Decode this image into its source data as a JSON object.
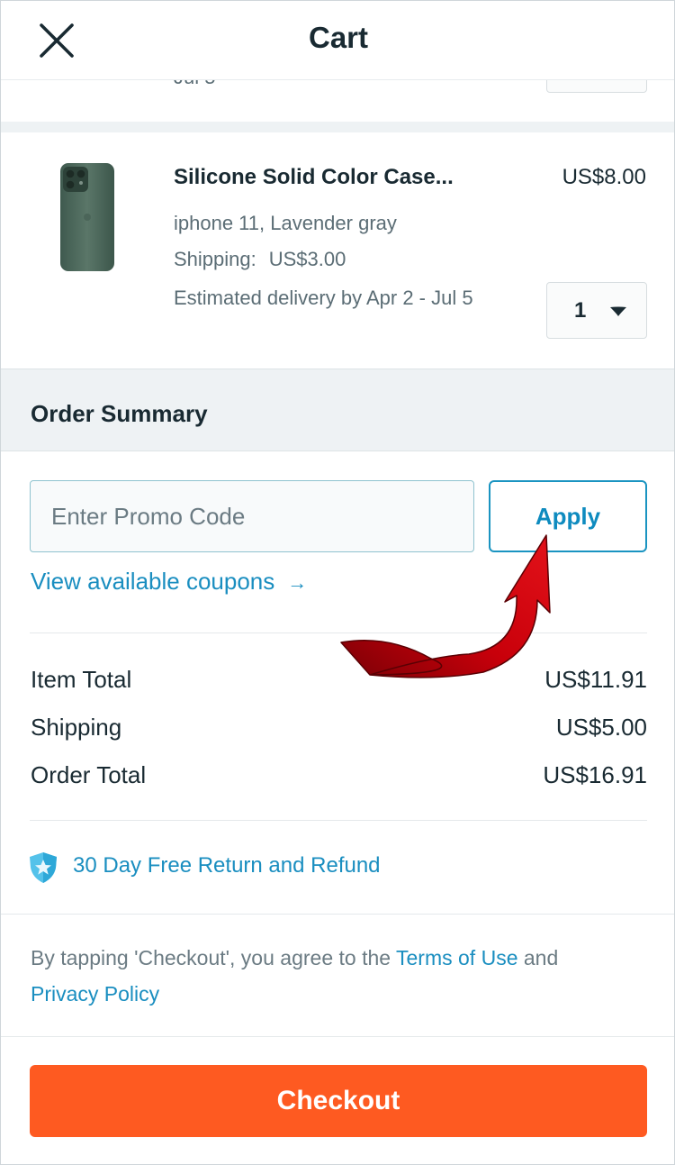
{
  "header": {
    "title": "Cart",
    "close_icon": "close-icon"
  },
  "previous_item": {
    "delivery_tail": "Jul 5"
  },
  "item": {
    "title": "Silicone Solid Color Case...",
    "price": "US$8.00",
    "variant": "iphone 11, Lavender gray",
    "shipping_label": "Shipping:",
    "shipping_value": "US$3.00",
    "delivery": "Estimated delivery by Apr 2 - Jul 5",
    "quantity": "1",
    "image_icon": "phone-case-image",
    "caret_icon": "caret-down-icon"
  },
  "summary": {
    "title": "Order Summary",
    "promo_placeholder": "Enter Promo Code",
    "apply_label": "Apply",
    "coupons_link": "View available coupons",
    "coupons_arrow_icon": "arrow-right-icon",
    "rows": [
      {
        "label": "Item Total",
        "value": "US$11.91"
      },
      {
        "label": "Shipping",
        "value": "US$5.00"
      },
      {
        "label": "Order Total",
        "value": "US$16.91"
      }
    ],
    "guarantee_text": "30 Day Free Return and Refund",
    "guarantee_icon": "shield-star-icon"
  },
  "legal": {
    "prefix": "By tapping 'Checkout', you agree to the ",
    "terms_link": "Terms of Use",
    "middle": " and",
    "privacy_link": "Privacy Policy"
  },
  "checkout": {
    "label": "Checkout"
  },
  "colors": {
    "accent_blue": "#1a8ec0",
    "checkout_orange": "#fe5a21",
    "annotation_red": "#c8000a"
  }
}
